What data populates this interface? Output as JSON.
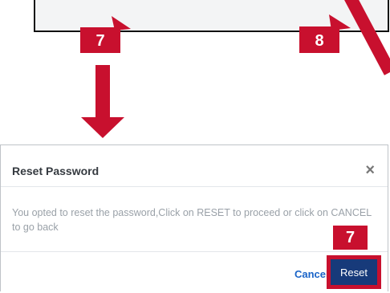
{
  "annotations": {
    "top_badge_left": "7",
    "top_badge_right": "8",
    "dialog_badge": "7"
  },
  "dialog": {
    "title": "Reset Password",
    "close_glyph": "×",
    "body_text": "You opted to reset the password,Click on RESET to proceed or click on CANCEL to go back",
    "cancel_label": "Cancel",
    "reset_label": "Reset"
  },
  "colors": {
    "annotation_red": "#c8102e",
    "primary_button": "#173a7a",
    "link_blue": "#1a64c8"
  }
}
